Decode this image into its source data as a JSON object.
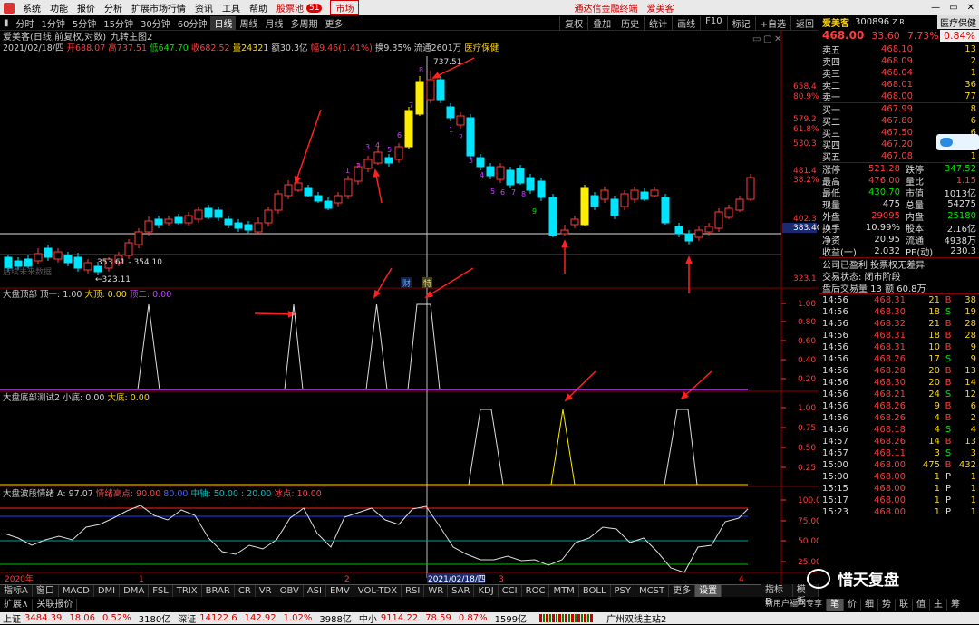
{
  "menu": {
    "items": [
      "系统",
      "功能",
      "报价",
      "分析",
      "扩展市场行情",
      "资讯",
      "工具",
      "帮助"
    ],
    "stock_pool": "股票池",
    "pool_count": "51",
    "market": "市场",
    "news": "通达信金融终端",
    "stock_name_top": "爱美客"
  },
  "toolbar": {
    "periods": [
      "分时",
      "1分钟",
      "5分钟",
      "15分钟",
      "30分钟",
      "60分钟",
      "日线",
      "周线",
      "月线",
      "多周期",
      "更多"
    ],
    "right": [
      "复权",
      "叠加",
      "历史",
      "统计",
      "画线",
      "F10",
      "标记",
      "+自选",
      "返回"
    ]
  },
  "chart": {
    "header": "爱美客(日线,前复权,对数)",
    "formula": "九转主图2",
    "info": {
      "date": "2021/02/18/四",
      "open": "开688.07",
      "high": "高737.51",
      "low": "低647.70",
      "close": "收682.52",
      "vol": "量24321",
      "amount": "额30.3亿",
      "change": "幅9.46(1.41%)",
      "turnover": "换9.35%",
      "float": "流通2601万",
      "industry": "医疗保健"
    },
    "peak_label": "737.51",
    "range_label": "353.61 - 354.10",
    "low_label": "←323.11",
    "watermark": "后续未来数据",
    "price_axis": [
      "658.4",
      "80.9%",
      "579.2",
      "61.8%",
      "530.3",
      "481.4",
      "38.2%",
      "402.3",
      "383.40",
      "323.1"
    ],
    "fin_label": "财",
    "event_label": "特"
  },
  "ind1": {
    "title": "大盘顶部",
    "v1": "顶一: 1.00",
    "v2": "大顶: 0.00",
    "v3": "顶二: 0.00",
    "axis": [
      "1.00",
      "0.80",
      "0.60",
      "0.40",
      "0.20"
    ]
  },
  "ind2": {
    "title": "大盘底部测试2",
    "v1": "小底: 0.00",
    "v2": "大底: 0.00",
    "axis": [
      "1.00",
      "0.75",
      "0.50",
      "0.25"
    ]
  },
  "ind3": {
    "title": "大盘波段情绪",
    "v1": "A: 97.07",
    "v2": "情绪高点: 90.00",
    "v3": "80.00",
    "v4": "中轴: 50.00 : 20.00",
    "v5": "冰点: 10.00",
    "axis": [
      "100.0",
      "75.00",
      "50.00",
      "25.00"
    ]
  },
  "xaxis": {
    "year": "2020年",
    "m1": "1",
    "m2": "2",
    "m3": "3",
    "m4": "4",
    "cursor": "2021/02/18/四"
  },
  "bottom_tabs": [
    "指标A",
    "窗口",
    "MACD",
    "DMI",
    "DMA",
    "FSL",
    "TRIX",
    "BRAR",
    "CR",
    "VR",
    "OBV",
    "ASI",
    "EMV",
    "VOL-TDX",
    "RSI",
    "WR",
    "SAR",
    "KDJ",
    "CCI",
    "ROC",
    "MTM",
    "BOLL",
    "PSY",
    "MCST",
    "更多",
    "设置"
  ],
  "ext": {
    "a": "扩展∧",
    "b": "关联报价"
  },
  "quote": {
    "name": "爱美客",
    "code": "300896",
    "tag": "Z R",
    "sector": "医疗保健",
    "price": "468.00",
    "chg": "33.60",
    "pct": "7.73%",
    "sector_pct": "0.84%",
    "asks": [
      [
        "卖五",
        "468.10",
        "13"
      ],
      [
        "卖四",
        "468.09",
        "2"
      ],
      [
        "卖三",
        "468.04",
        "1"
      ],
      [
        "卖二",
        "468.01",
        "36"
      ],
      [
        "卖一",
        "468.00",
        "77"
      ]
    ],
    "bids": [
      [
        "买一",
        "467.99",
        "8"
      ],
      [
        "买二",
        "467.80",
        "6"
      ],
      [
        "买三",
        "467.50",
        "6"
      ],
      [
        "买四",
        "467.20",
        "1"
      ],
      [
        "买五",
        "467.08",
        "1"
      ]
    ],
    "stats": [
      [
        "涨停",
        "521.28",
        "跌停",
        "347.52"
      ],
      [
        "最高",
        "476.00",
        "量比",
        "1.15"
      ],
      [
        "最低",
        "430.70",
        "市值",
        "1013亿"
      ],
      [
        "现量",
        "475",
        "总量",
        "54275"
      ],
      [
        "外盘",
        "29095",
        "内盘",
        "25180"
      ],
      [
        "换手",
        "10.99%",
        "股本",
        "2.16亿"
      ],
      [
        "净资",
        "20.95",
        "流通",
        "4938万"
      ],
      [
        "收益(一)",
        "2.032",
        "PE(动)",
        "230.3"
      ]
    ],
    "notes": [
      "公司已盈利 投票权无差异",
      "交易状态: 闭市阶段",
      "盘后交易量 13 额 60.8万"
    ],
    "ticks": [
      [
        "14:56",
        "468.31",
        "21",
        "B",
        "38"
      ],
      [
        "14:56",
        "468.30",
        "18",
        "S",
        "19"
      ],
      [
        "14:56",
        "468.32",
        "21",
        "B",
        "28"
      ],
      [
        "14:56",
        "468.31",
        "18",
        "B",
        "28"
      ],
      [
        "14:56",
        "468.31",
        "10",
        "B",
        "9"
      ],
      [
        "14:56",
        "468.26",
        "17",
        "S",
        "9"
      ],
      [
        "14:56",
        "468.28",
        "20",
        "B",
        "13"
      ],
      [
        "14:56",
        "468.30",
        "20",
        "B",
        "14"
      ],
      [
        "14:56",
        "468.21",
        "24",
        "S",
        "12"
      ],
      [
        "14:56",
        "468.26",
        "9",
        "B",
        "6"
      ],
      [
        "14:56",
        "468.26",
        "4",
        "B",
        "2"
      ],
      [
        "14:56",
        "468.18",
        "4",
        "S",
        "4"
      ],
      [
        "14:57",
        "468.26",
        "14",
        "B",
        "13"
      ],
      [
        "14:57",
        "468.11",
        "3",
        "S",
        "3"
      ],
      [
        "15:00",
        "468.00",
        "475",
        "B",
        "432"
      ],
      [
        "15:00",
        "468.00",
        "1",
        "P",
        "1"
      ],
      [
        "15:15",
        "468.00",
        "1",
        "P",
        "1"
      ],
      [
        "15:17",
        "468.00",
        "1",
        "P",
        "1"
      ],
      [
        "15:23",
        "468.00",
        "1",
        "P",
        "1"
      ]
    ],
    "tabs": [
      "笔",
      "价",
      "细",
      "势",
      "联",
      "值",
      "主",
      "筹"
    ],
    "newuser": "新用户福利专享",
    "ind_btn": "指标B",
    "tpl": "模板"
  },
  "status": {
    "sh_label": "上证",
    "sh": "3484.39",
    "sh_chg": "18.06",
    "sh_pct": "0.52%",
    "sh_amt": "3180亿",
    "sz_label": "深证",
    "sz": "14122.6",
    "sz_chg": "142.92",
    "sz_pct": "1.02%",
    "sz_amt": "3988亿",
    "zx_label": "中小",
    "zx": "9114.22",
    "zx_chg": "78.59",
    "zx_pct": "0.87%",
    "zx_amt": "1599亿",
    "server": "广州双线主站2"
  },
  "wechat": "惜天复盘",
  "colors": {
    "up": "#ff3c3c",
    "down": "#00e5ff",
    "yellow": "#ffee00",
    "purple": "#c040ff",
    "arrow": "#ff2020"
  }
}
